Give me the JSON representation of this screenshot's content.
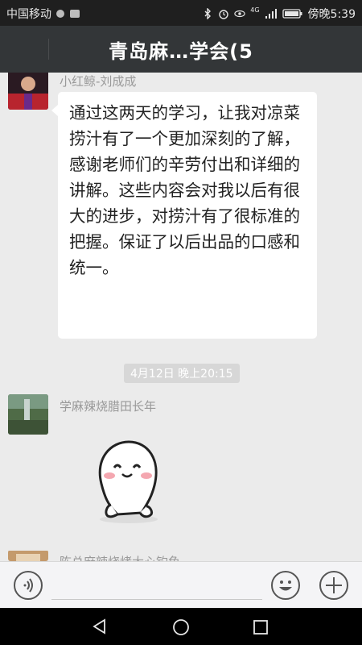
{
  "status_bar": {
    "carrier": "中国移动",
    "time": "傍晚5:39",
    "signal_label": "4G"
  },
  "header": {
    "title": "青岛麻…学会(5"
  },
  "messages": [
    {
      "sender": "小红鲸-刘成成",
      "text": "通过这两天的学习，让我对凉菜捞汁有了一个更加深刻的了解，感谢老师们的辛劳付出和详细的讲解。这些内容会对我以后有很大的进步，对捞汁有了很标准的把握。保证了以后出品的口感和统一。"
    },
    {
      "sender": "学麻辣烧腊田长年",
      "sticker": "happy-dumpling-sticker"
    },
    {
      "sender": "陈总麻辣烧烤大心钓鱼"
    }
  ],
  "timestamp": "4月12日 晚上20:15",
  "colors": {
    "header_bg": "#333638",
    "chat_bg": "#ebebeb",
    "bubble_bg": "#ffffff",
    "sender_text": "#999999"
  },
  "input_bar": {
    "icons": [
      "voice-icon",
      "emoji-icon",
      "plus-icon"
    ]
  },
  "nav_bar": {
    "icons": [
      "back-icon",
      "home-icon",
      "recents-icon"
    ]
  }
}
